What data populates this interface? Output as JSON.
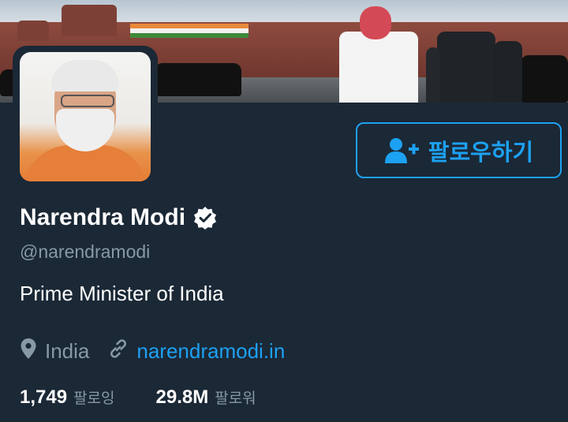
{
  "profile": {
    "name": "Narendra Modi",
    "handle": "@narendramodi",
    "bio": "Prime Minister of India",
    "location": "India",
    "website": "narendramodi.in",
    "verified": true
  },
  "follow_button": {
    "label": "팔로우하기"
  },
  "stats": {
    "following_count": "1,749",
    "following_label": "팔로잉",
    "followers_count": "29.8M",
    "followers_label": "팔로워"
  },
  "icons": {
    "verified": "verified-badge-icon",
    "follow": "add-user-icon",
    "location": "location-pin-icon",
    "link": "link-icon"
  },
  "colors": {
    "background": "#1b2836",
    "accent": "#1da1f2",
    "secondary_text": "#8899a6",
    "primary_text": "#ffffff"
  }
}
